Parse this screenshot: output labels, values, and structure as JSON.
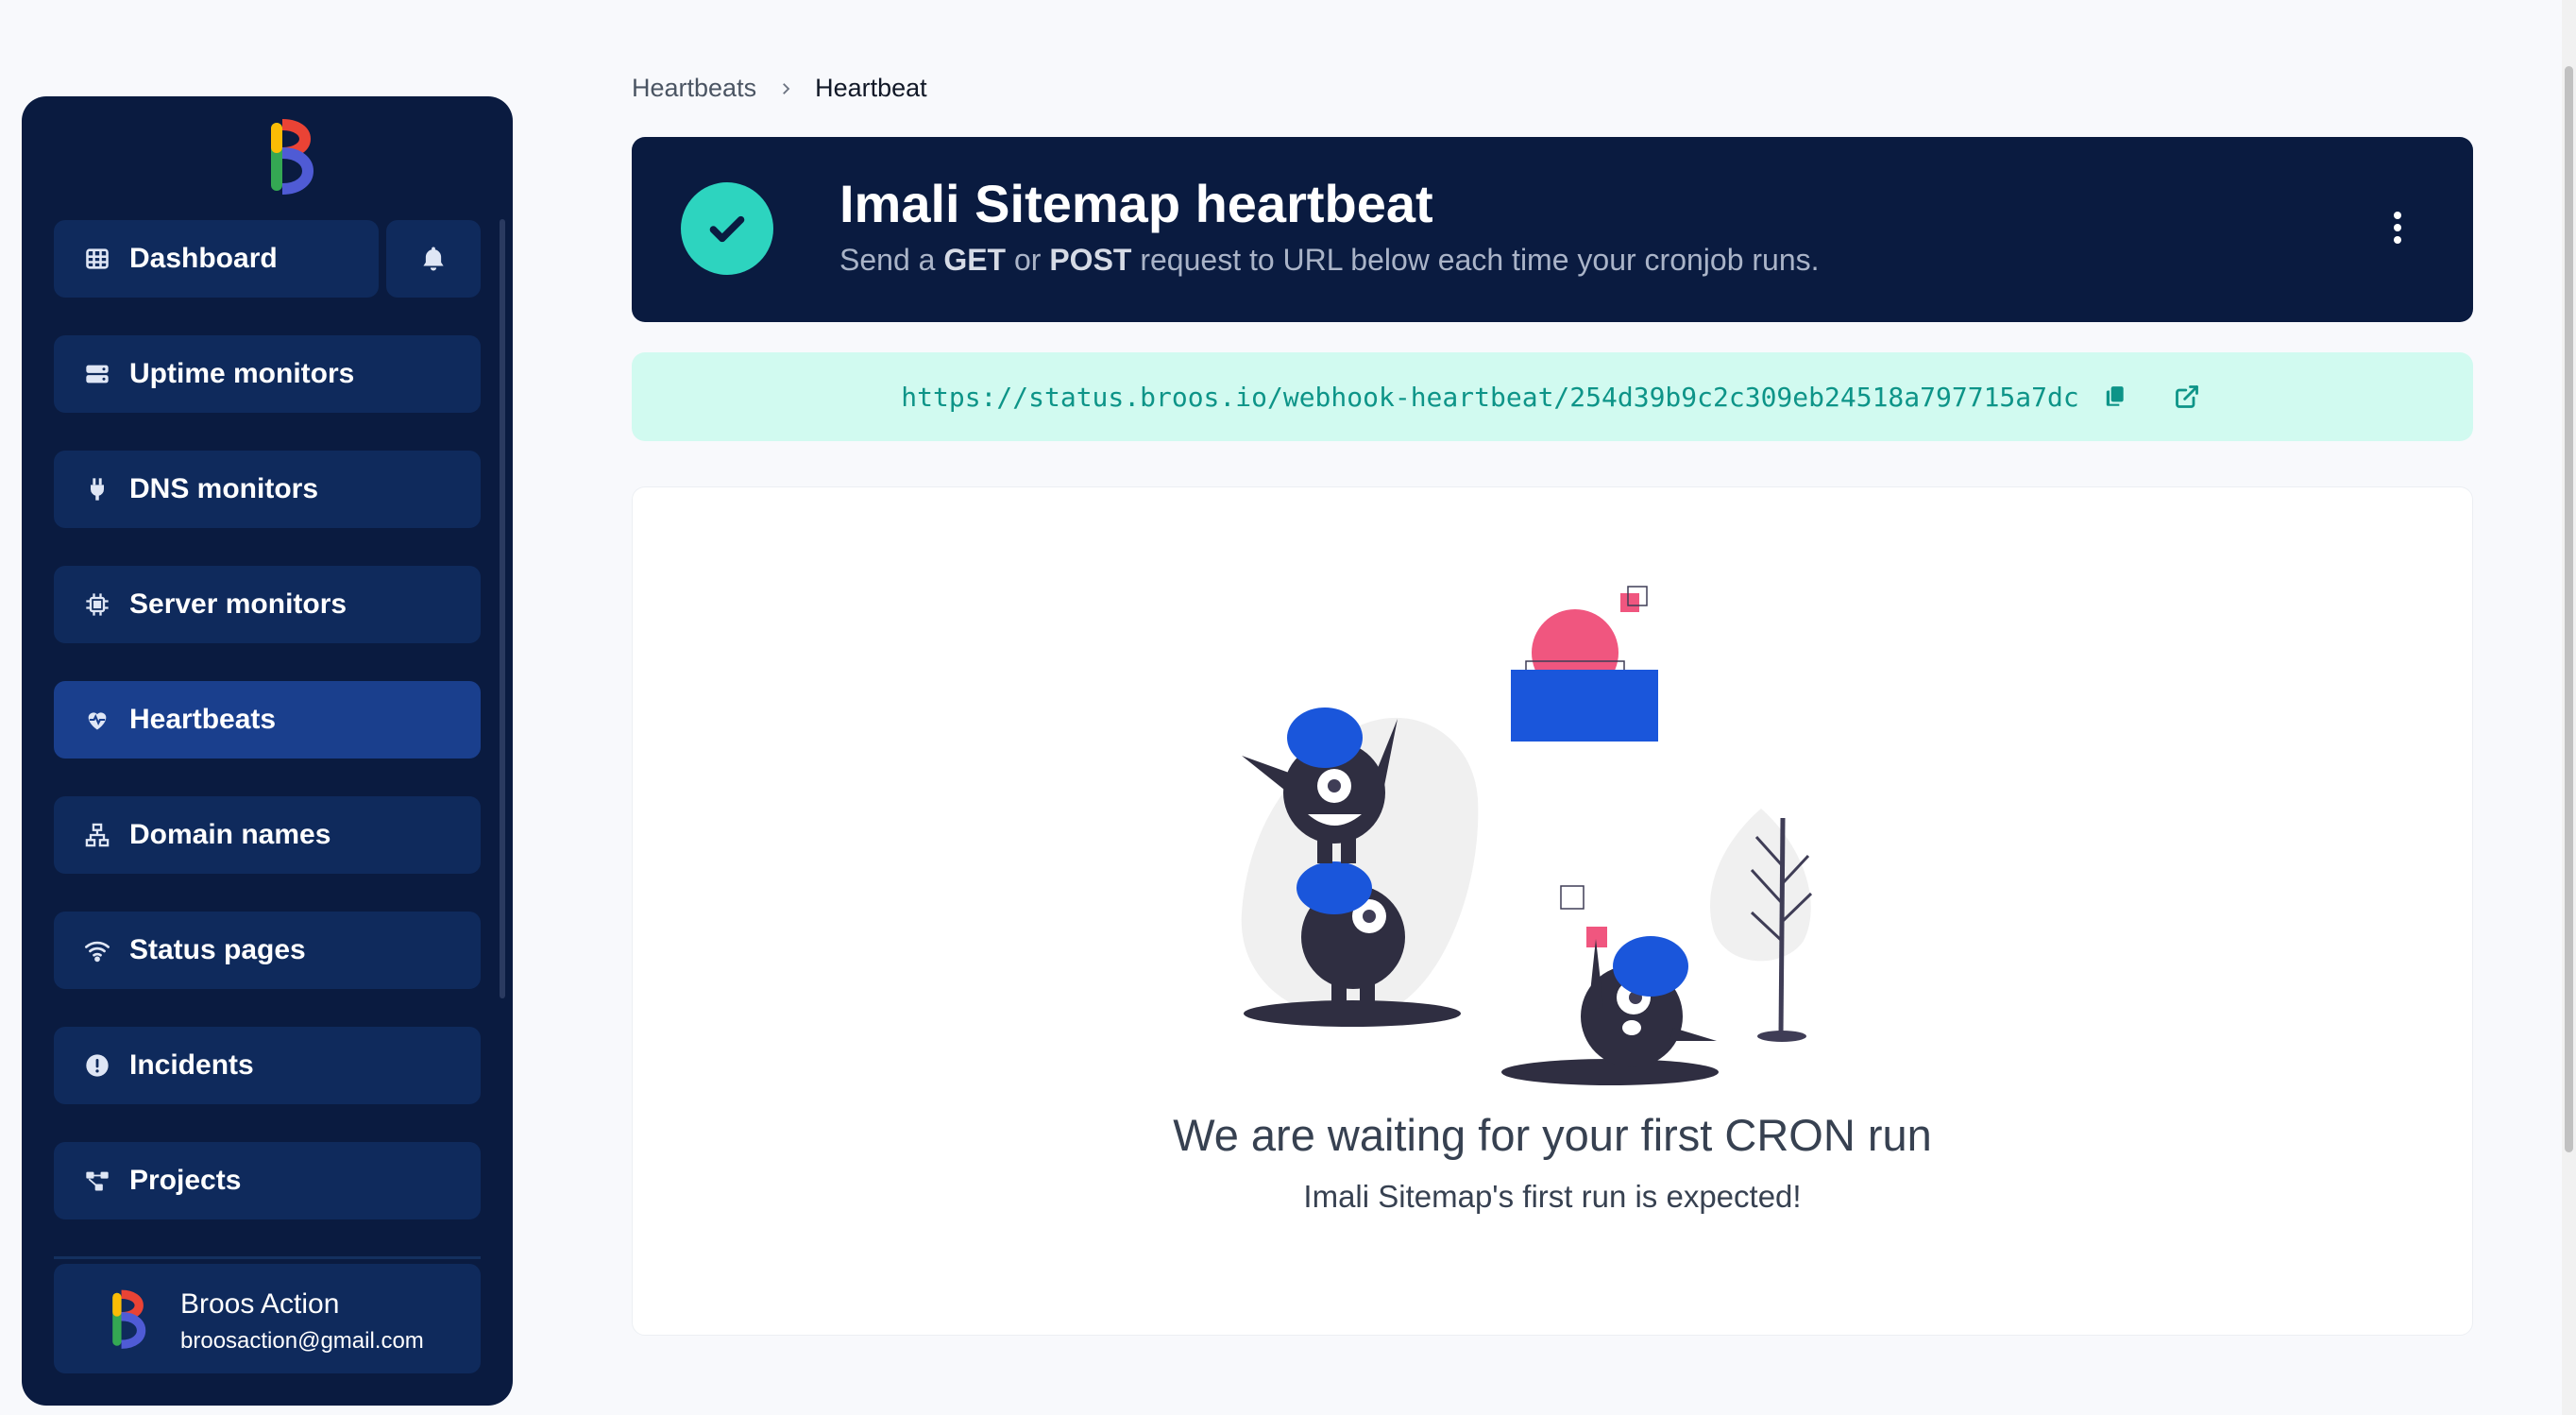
{
  "sidebar": {
    "dashboard_label": "Dashboard",
    "items": [
      {
        "label": "Uptime monitors",
        "icon": "server-icon"
      },
      {
        "label": "DNS monitors",
        "icon": "plug-icon"
      },
      {
        "label": "Server monitors",
        "icon": "chip-icon"
      },
      {
        "label": "Heartbeats",
        "icon": "heart-pulse-icon",
        "active": true
      },
      {
        "label": "Domain names",
        "icon": "sitemap-icon"
      },
      {
        "label": "Status pages",
        "icon": "wifi-icon"
      },
      {
        "label": "Incidents",
        "icon": "exclamation-icon"
      },
      {
        "label": "Projects",
        "icon": "project-diagram-icon"
      }
    ],
    "profile": {
      "name": "Broos Action",
      "email": "broosaction@gmail.com"
    }
  },
  "breadcrumb": {
    "parent": "Heartbeats",
    "current": "Heartbeat"
  },
  "hero": {
    "title": "Imali Sitemap heartbeat",
    "sub_prefix": "Send a",
    "method_get": "GET",
    "sub_or": "or",
    "method_post": "POST",
    "sub_suffix": "request to URL below each time your cronjob runs."
  },
  "webhook": {
    "url": "https://status.broos.io/webhook-heartbeat/254d39b9c2c309eb24518a797715a7dc"
  },
  "empty_state": {
    "title": "We are waiting for your first CRON run",
    "subtitle": "Imali Sitemap's first run is expected!"
  },
  "colors": {
    "sidebar_bg": "#0a1b40",
    "nav_item_bg": "#0f2a5c",
    "nav_active_bg": "#1a3f8d",
    "accent_teal": "#2dd4bf",
    "url_bg": "#d1faf0",
    "url_text": "#0d9488"
  }
}
